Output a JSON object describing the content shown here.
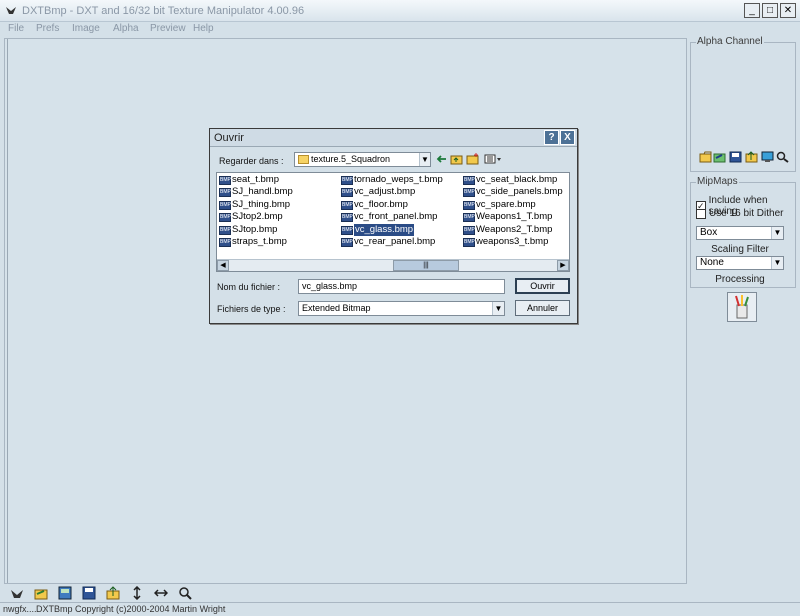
{
  "window": {
    "title": "DXTBmp - DXT and 16/32 bit Texture Manipulator 4.00.96"
  },
  "menu": [
    "File",
    "Prefs",
    "Image",
    "Alpha",
    "Preview",
    "Help"
  ],
  "side": {
    "alpha_channel_label": "Alpha Channel",
    "mipmaps_label": "MipMaps",
    "include_when_saving": "Include when saving",
    "include_checked": true,
    "use_16bit_dither": "Use 16 bit Dither",
    "dither_checked": false,
    "scaling_value": "Box",
    "scaling_filter_label": "Scaling Filter",
    "processing_value": "None",
    "processing_label": "Processing"
  },
  "dialog": {
    "title": "Ouvrir",
    "help_btn": "?",
    "close_btn": "X",
    "look_in_label": "Regarder dans :",
    "look_in_value": "texture.5_Squadron",
    "files": {
      "col1": [
        "seat_t.bmp",
        "SJ_handl.bmp",
        "SJ_thing.bmp",
        "SJtop2.bmp",
        "SJtop.bmp",
        "straps_t.bmp"
      ],
      "col2": [
        "tornado_weps_t.bmp",
        "vc_adjust.bmp",
        "vc_floor.bmp",
        "vc_front_panel.bmp",
        "vc_glass.bmp",
        "vc_rear_panel.bmp"
      ],
      "col3": [
        "vc_seat_black.bmp",
        "vc_side_panels.bmp",
        "vc_spare.bmp",
        "Weapons1_T.bmp",
        "Weapons2_T.bmp",
        "weapons3_t.bmp"
      ],
      "selected": "vc_glass.bmp"
    },
    "filename_label": "Nom du fichier :",
    "filename_value": "vc_glass.bmp",
    "filetype_label": "Fichiers de type :",
    "filetype_value": "Extended Bitmap",
    "open_btn": "Ouvrir",
    "cancel_btn": "Annuler"
  },
  "status": {
    "left": "nwgfx....",
    "right": "DXTBmp Copyright (c)2000-2004 Martin Wright"
  }
}
